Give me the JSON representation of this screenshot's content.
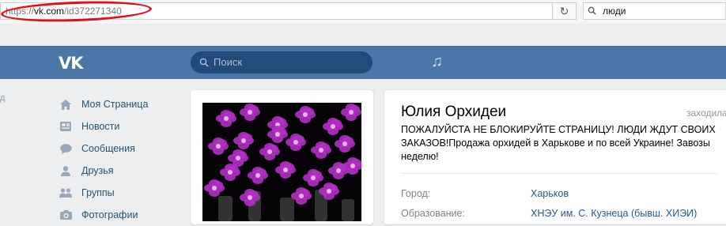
{
  "browser": {
    "url_scheme": "https://",
    "url_host": "vk.com",
    "url_path": "/id372271340",
    "reload_icon": "reload-icon",
    "search_value": "люди"
  },
  "header": {
    "logo": "VK",
    "search_placeholder": "Поиск",
    "brand_color": "#4a76a8"
  },
  "left_fragment": "д",
  "nav": [
    {
      "label": "Моя Страница",
      "icon": "home-icon"
    },
    {
      "label": "Новости",
      "icon": "news-icon"
    },
    {
      "label": "Сообщения",
      "icon": "messages-icon"
    },
    {
      "label": "Друзья",
      "icon": "friends-icon"
    },
    {
      "label": "Группы",
      "icon": "groups-icon"
    },
    {
      "label": "Фотографии",
      "icon": "photos-icon"
    }
  ],
  "profile": {
    "name": "Юлия Орхидеи",
    "online": "заходила",
    "status": "ПОЖАЛУЙСТА НЕ БЛОКИРУЙТЕ СТРАНИЦУ! ЛЮДИ ЖДУТ СВОИХ ЗАКАЗОВ!Продажа орхидей в Харькове и по всей Украине! Завозы неделю!",
    "city_label": "Город:",
    "city_value": "Харьков",
    "education_label": "Образование:",
    "education_value": "ХНЭУ им. С. Кузнеца (бывш. ХИЭИ)"
  }
}
